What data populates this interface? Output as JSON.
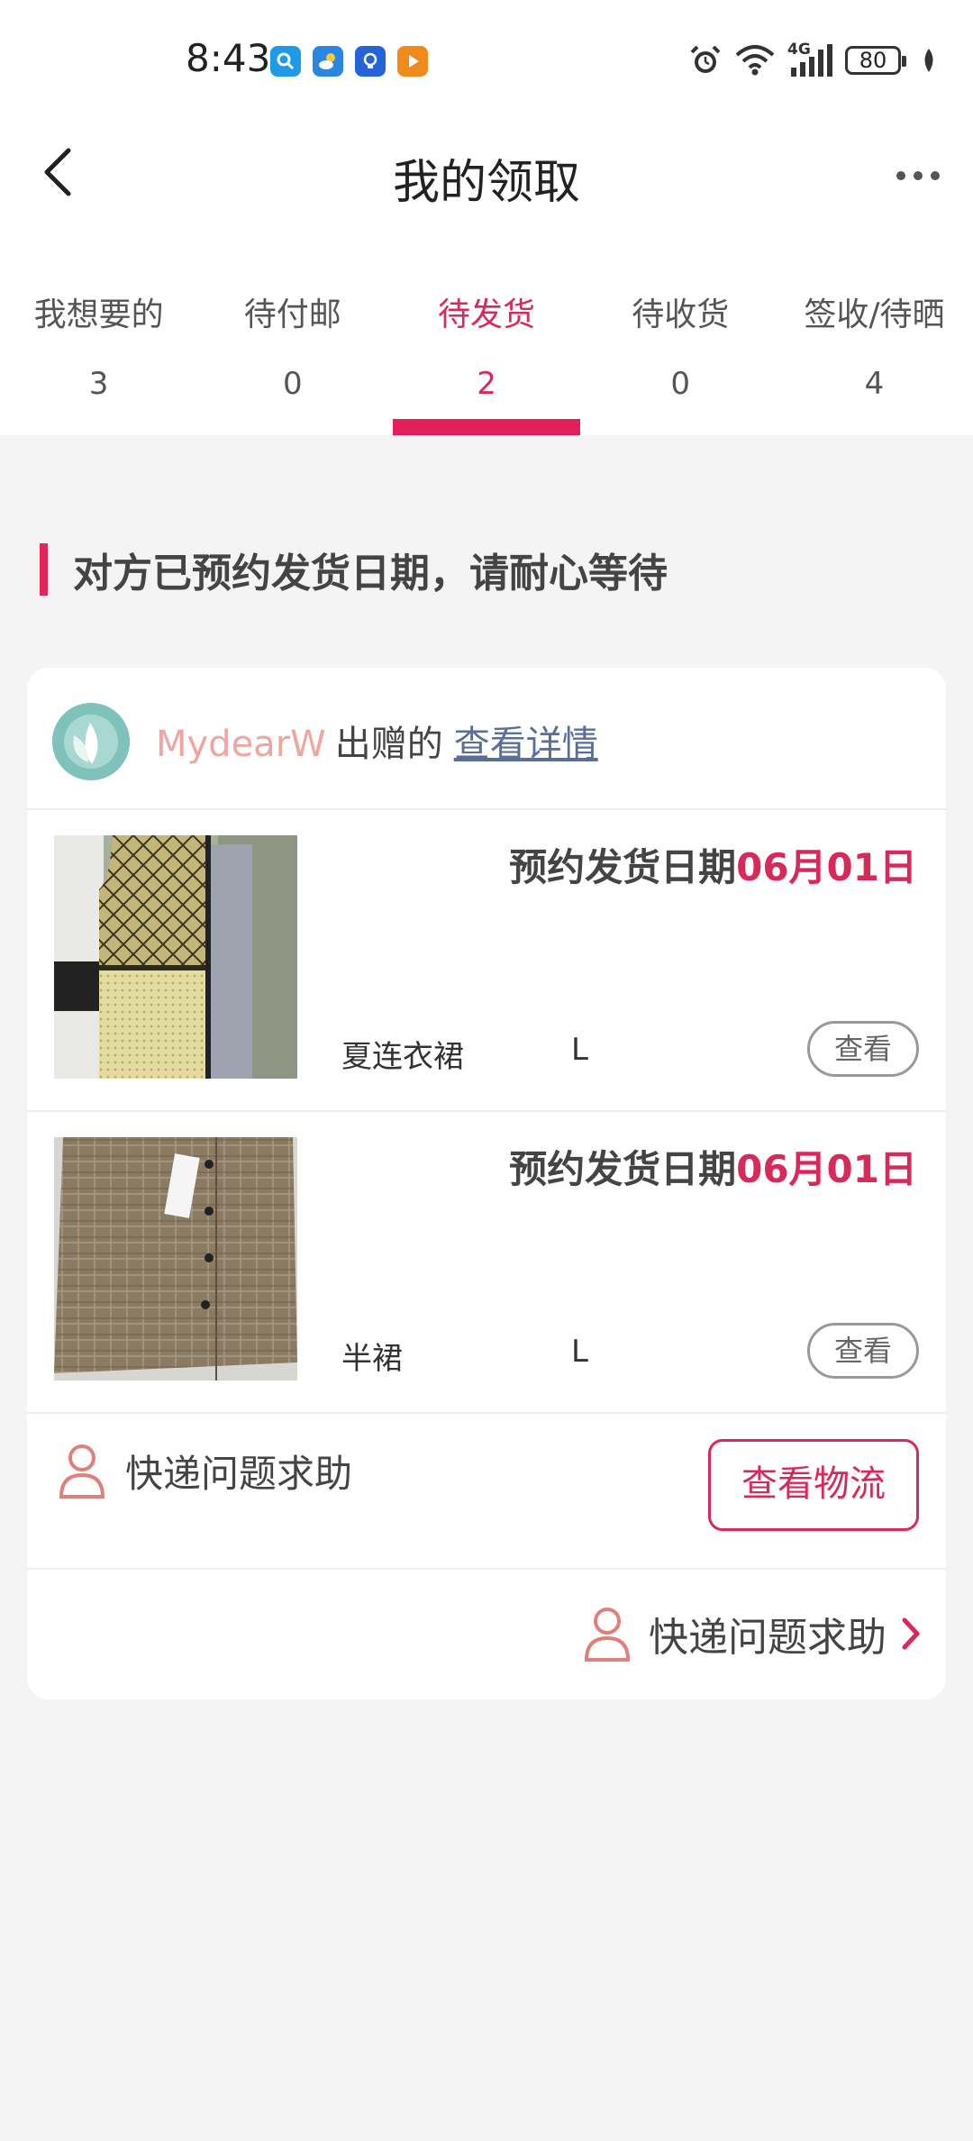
{
  "status_bar": {
    "time": "8:43",
    "network": "4G",
    "battery": "80"
  },
  "nav": {
    "title": "我的领取"
  },
  "tabs": [
    {
      "label": "我想要的",
      "count": "3"
    },
    {
      "label": "待付邮",
      "count": "0"
    },
    {
      "label": "待发货",
      "count": "2",
      "active": true
    },
    {
      "label": "待收货",
      "count": "0"
    },
    {
      "label": "签收/待晒",
      "count": "4"
    }
  ],
  "notice": "对方已预约发货日期，请耐心等待",
  "card": {
    "giver_name": "MydearW",
    "giver_suffix": "出赠的",
    "detail_link": "查看详情",
    "items": [
      {
        "ship_label": "预约发货日期",
        "ship_date": "06月01日",
        "name": "夏连衣裙",
        "size": "L",
        "view": "查看"
      },
      {
        "ship_label": "预约发货日期",
        "ship_date": "06月01日",
        "name": "半裙",
        "size": "L",
        "view": "查看"
      }
    ],
    "help_label": "快递问题求助",
    "logistics_button": "查看物流",
    "help_bottom_label": "快递问题求助"
  },
  "colors": {
    "accent": "#d9285a",
    "giver_name": "#eea6a1",
    "link": "#5a6e96",
    "background": "#f4f4f4"
  },
  "icons": [
    "back-icon",
    "more-icon",
    "person-icon",
    "chevron-right-icon",
    "alarm-icon",
    "wifi-icon",
    "signal-icon"
  ]
}
